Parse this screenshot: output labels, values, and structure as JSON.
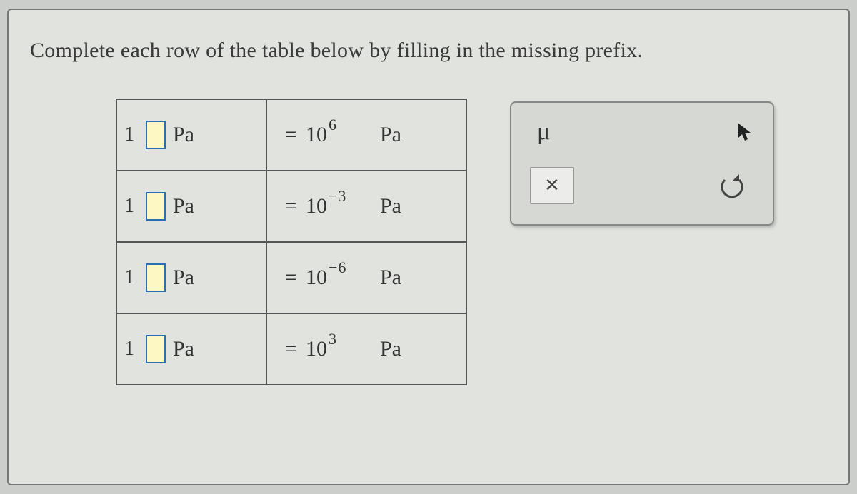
{
  "prompt": "Complete each row of the table below by filling in the missing prefix.",
  "rows": [
    {
      "coef": "1",
      "unit": "Pa",
      "eq": "=",
      "base": "10",
      "exp": "6",
      "r_unit": "Pa"
    },
    {
      "coef": "1",
      "unit": "Pa",
      "eq": "=",
      "base": "10",
      "exp": "−3",
      "r_unit": "Pa"
    },
    {
      "coef": "1",
      "unit": "Pa",
      "eq": "=",
      "base": "10",
      "exp": "−6",
      "r_unit": "Pa"
    },
    {
      "coef": "1",
      "unit": "Pa",
      "eq": "=",
      "base": "10",
      "exp": "3",
      "r_unit": "Pa"
    }
  ],
  "helper": {
    "mu": "μ",
    "close": "✕"
  }
}
